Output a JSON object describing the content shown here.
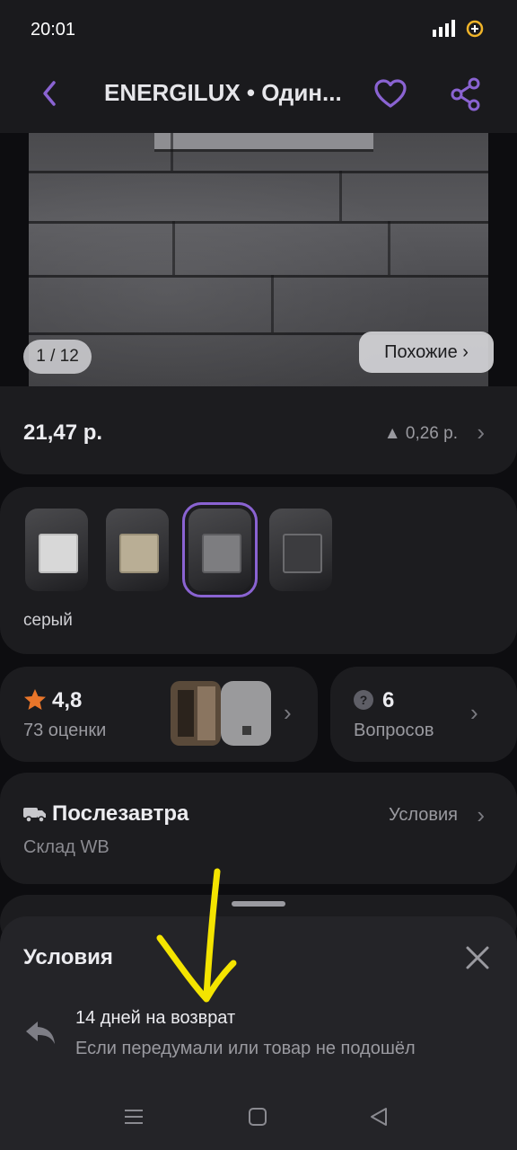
{
  "status": {
    "time": "20:01"
  },
  "header": {
    "title": "ENERGILUX • Один..."
  },
  "gallery": {
    "counter": "1 / 12",
    "similar_label": "Похожие ›"
  },
  "price": {
    "value": "21,47 р.",
    "change": "▲ 0,26 р."
  },
  "colors": {
    "selected_name": "серый",
    "thumb_count": 4,
    "selected_index": 2
  },
  "rating": {
    "value": "4,8",
    "count_label": "73 оценки"
  },
  "questions": {
    "count": "6",
    "label": "Вопросов"
  },
  "delivery": {
    "title": "Послезавтра",
    "source": "Склад WB",
    "conditions_label": "Условия"
  },
  "sheet": {
    "title": "Условия",
    "return_title": "14 дней на возврат",
    "return_subtitle": "Если передумали или товар не подошёл"
  },
  "colors_palette": {
    "accent": "#8a63d2",
    "annotation_arrow": "#f4e400",
    "star": "#e8752a"
  }
}
